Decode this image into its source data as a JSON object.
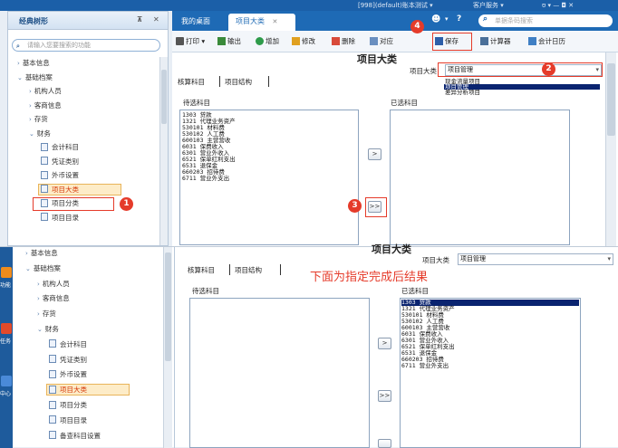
{
  "top_strip": {
    "left_text": "[998](default)账本测试 ▾",
    "service": "客户服务 ▾",
    "window_icons": "ʊ ▾ — ◘ ✕"
  },
  "tree_panel": {
    "title": "经典树形",
    "pin": "⊼",
    "close": "✕",
    "search_placeholder": "请输入您要搜索的功能",
    "nodes": [
      {
        "label": "基本信息",
        "level": 0,
        "kind": "collapsed"
      },
      {
        "label": "基础档案",
        "level": 0,
        "kind": "expanded"
      },
      {
        "label": "机构人员",
        "level": 1,
        "kind": "collapsed"
      },
      {
        "label": "客商信息",
        "level": 1,
        "kind": "collapsed"
      },
      {
        "label": "存货",
        "level": 1,
        "kind": "collapsed"
      },
      {
        "label": "财务",
        "level": 1,
        "kind": "expanded"
      },
      {
        "label": "会计科目",
        "level": 2,
        "kind": "leaf"
      },
      {
        "label": "凭证类别",
        "level": 2,
        "kind": "leaf"
      },
      {
        "label": "外币设置",
        "level": 2,
        "kind": "leaf"
      },
      {
        "label": "项目大类",
        "level": 2,
        "kind": "leaf",
        "selected": true
      },
      {
        "label": "项目分类",
        "level": 2,
        "kind": "leaf"
      },
      {
        "label": "项目目录",
        "level": 2,
        "kind": "leaf"
      }
    ]
  },
  "tabs": [
    {
      "label": "我的桌面",
      "active": false
    },
    {
      "label": "项目大类",
      "active": true,
      "close": "✕"
    }
  ],
  "tab_right": {
    "search_placeholder": "单据条码搜索"
  },
  "toolbar": {
    "print": "打印",
    "export": "输出",
    "add": "增加",
    "edit": "修改",
    "delete": "删除",
    "match": "对应",
    "save": "保存",
    "calculator": "计算器",
    "calendar": "会计日历"
  },
  "main": {
    "title": "项目大类",
    "category_label": "项目大类",
    "category_value": "项目管理",
    "dropdown_options": [
      "现金流量项目",
      "项目管理",
      "差异分析项目"
    ],
    "dropdown_selected_index": 1,
    "subtabs": [
      "核算科目",
      "项目结构"
    ],
    "pending_label": "待选科目",
    "selected_label": "已选科目",
    "pending_items": [
      "1303 贷款",
      "1321 代理业务资产",
      "530101 材料费",
      "530102 人工费",
      "600103 主营营收",
      "6031 保费收入",
      "6301 营业外收入",
      "6521 保单红利支出",
      "6531 退保金",
      "660203 招待费",
      "6711 营业外支出"
    ],
    "btn_single": ">",
    "btn_all": ">>"
  },
  "bottom": {
    "title": "项目大类",
    "category_label": "项目大类",
    "category_value": "项目管理",
    "subtabs": [
      "核算科目",
      "项目结构"
    ],
    "pending_label": "待选科目",
    "selected_label": "已选科目",
    "annotation": "下面为指定完成后结果",
    "selected_items": [
      "1303 贷款",
      "1321 代理业务资产",
      "530101 材料费",
      "530102 人工费",
      "600103 主营营收",
      "6031 保费收入",
      "6301 营业外收入",
      "6521 保单红利支出",
      "6531 退保金",
      "660203 招待费",
      "6711 营业外支出"
    ],
    "btn_single": ">",
    "btn_all": ">>",
    "left_rail": [
      "导航",
      "功能",
      "任务",
      "中心"
    ],
    "tree_nodes": [
      {
        "label": "基本信息",
        "level": 0,
        "kind": "collapsed"
      },
      {
        "label": "基础档案",
        "level": 0,
        "kind": "expanded"
      },
      {
        "label": "机构人员",
        "level": 1,
        "kind": "collapsed"
      },
      {
        "label": "客商信息",
        "level": 1,
        "kind": "collapsed"
      },
      {
        "label": "存货",
        "level": 1,
        "kind": "collapsed"
      },
      {
        "label": "财务",
        "level": 1,
        "kind": "expanded"
      },
      {
        "label": "会计科目",
        "level": 2,
        "kind": "leaf"
      },
      {
        "label": "凭证类别",
        "level": 2,
        "kind": "leaf"
      },
      {
        "label": "外币设置",
        "level": 2,
        "kind": "leaf"
      },
      {
        "label": "项目大类",
        "level": 2,
        "kind": "leaf",
        "selected": true
      },
      {
        "label": "项目分类",
        "level": 2,
        "kind": "leaf"
      },
      {
        "label": "项目目录",
        "level": 2,
        "kind": "leaf"
      },
      {
        "label": "备查科目设置",
        "level": 2,
        "kind": "leaf"
      }
    ]
  },
  "step_badges": [
    "1",
    "2",
    "3",
    "4"
  ],
  "colors": {
    "accent": "#1e6ab5",
    "marker": "#e53b2a",
    "selected": "#0a2470"
  }
}
